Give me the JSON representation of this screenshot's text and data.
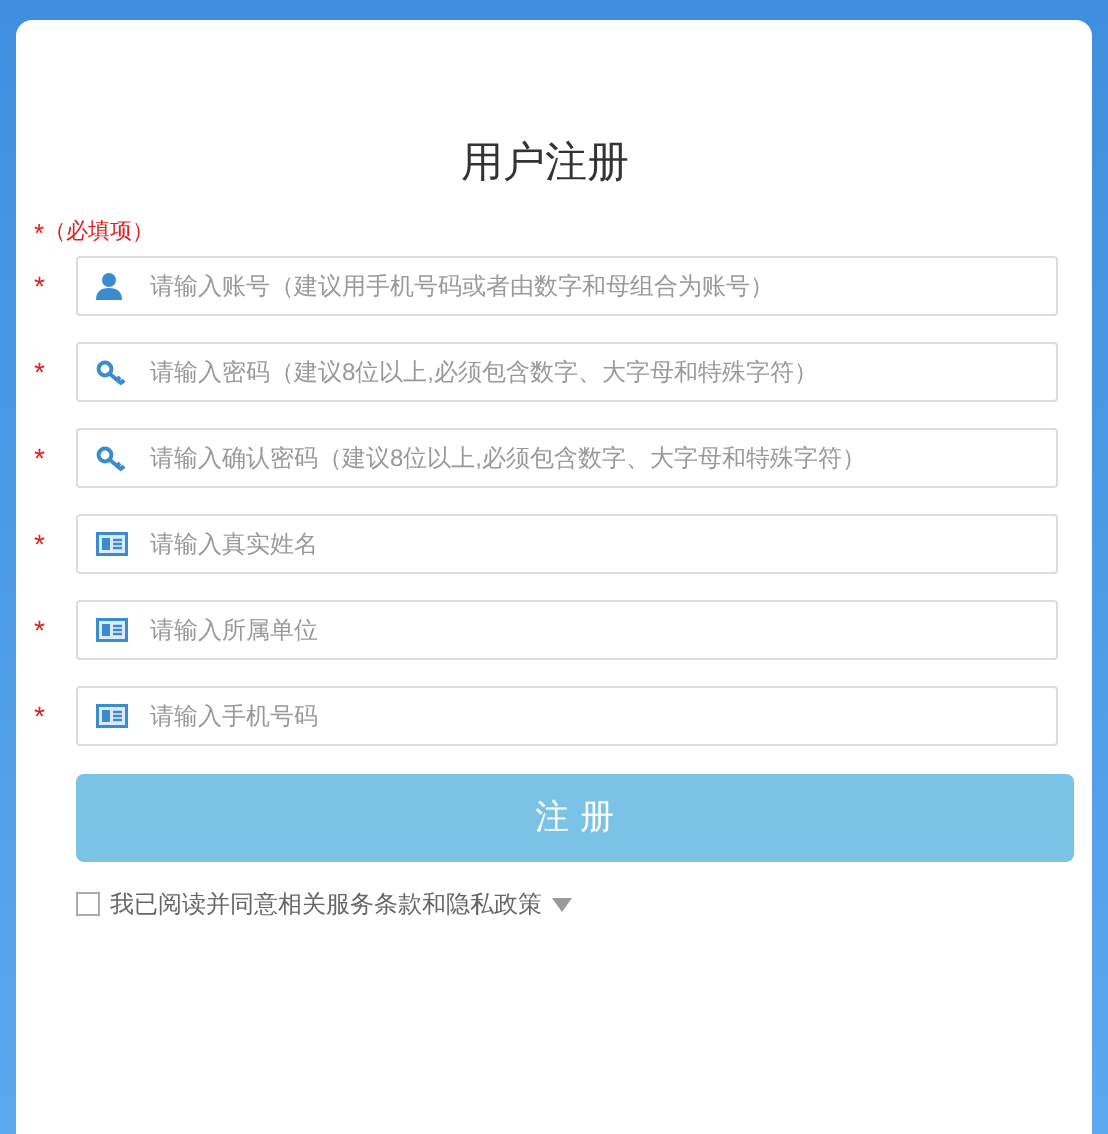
{
  "title": "用户注册",
  "required_note": {
    "mark": "*",
    "text": "（必填项）"
  },
  "fields": [
    {
      "kind": "user",
      "mark": "*",
      "placeholder": "请输入账号（建议用手机号码或者由数字和母组合为账号）"
    },
    {
      "kind": "key",
      "mark": "*",
      "placeholder": "请输入密码（建议8位以上,必须包含数字、大字母和特殊字符）"
    },
    {
      "kind": "key",
      "mark": "*",
      "placeholder": "请输入确认密码（建议8位以上,必须包含数字、大字母和特殊字符）"
    },
    {
      "kind": "card",
      "mark": "*",
      "placeholder": "请输入真实姓名"
    },
    {
      "kind": "card",
      "mark": "*",
      "placeholder": "请输入所属单位"
    },
    {
      "kind": "card",
      "mark": "*",
      "placeholder": "请输入手机号码"
    }
  ],
  "submit": "注 册",
  "agreement": {
    "checked": false,
    "text": "我已阅读并同意相关服务条款和隐私政策"
  }
}
